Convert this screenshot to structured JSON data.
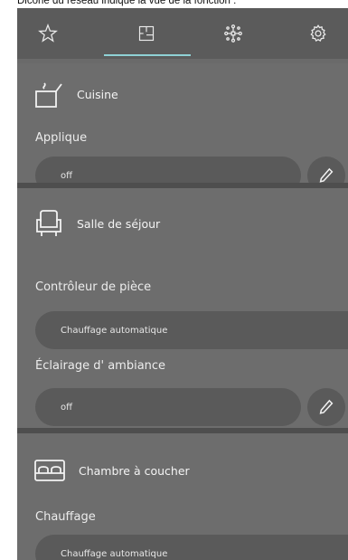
{
  "caption": "Dicone du réseau indique la vue de la fonction :",
  "tabs": [
    {
      "name": "favorites",
      "icon": "star-icon"
    },
    {
      "name": "rooms",
      "icon": "floorplan-icon",
      "active": true
    },
    {
      "name": "functions",
      "icon": "network-icon"
    },
    {
      "name": "settings",
      "icon": "gear-icon"
    }
  ],
  "colors": {
    "accent": "#8fd2d6",
    "background": "#6a6a6a",
    "pill": "#5a5a5a"
  },
  "rooms": [
    {
      "name": "Cuisine",
      "icon": "kitchen-pot-icon",
      "devices": [
        {
          "label": "Applique",
          "value": "off",
          "editable": true
        }
      ]
    },
    {
      "name": "Salle de séjour",
      "icon": "armchair-icon",
      "devices": [
        {
          "label": "Contrôleur de pièce",
          "value": "Chauffage automatique",
          "editable": false
        },
        {
          "label": "Éclairage d' ambiance",
          "value": "off",
          "editable": true
        }
      ]
    },
    {
      "name": "Chambre à coucher",
      "icon": "bed-icon",
      "devices": [
        {
          "label": "Chauffage",
          "value": "Chauffage automatique",
          "editable": false
        }
      ]
    }
  ]
}
